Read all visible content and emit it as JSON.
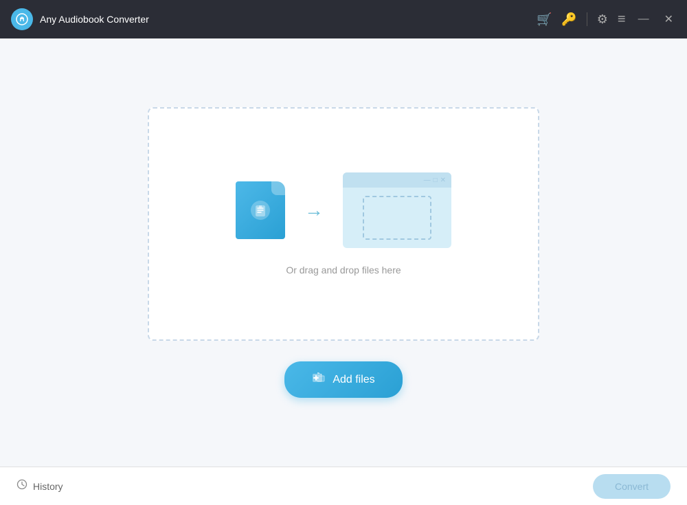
{
  "app": {
    "title": "Any Audiobook Converter",
    "logo_icon": "📖"
  },
  "titlebar": {
    "cart_icon": "🛒",
    "key_icon": "🔑",
    "settings_icon": "⚙",
    "menu_icon": "≡",
    "minimize_icon": "—",
    "close_icon": "✕"
  },
  "dropzone": {
    "drag_text": "Or drag and drop files here"
  },
  "add_files_btn": {
    "label": "Add files",
    "icon": "📂"
  },
  "bottom": {
    "history_label": "History",
    "convert_label": "Convert"
  }
}
